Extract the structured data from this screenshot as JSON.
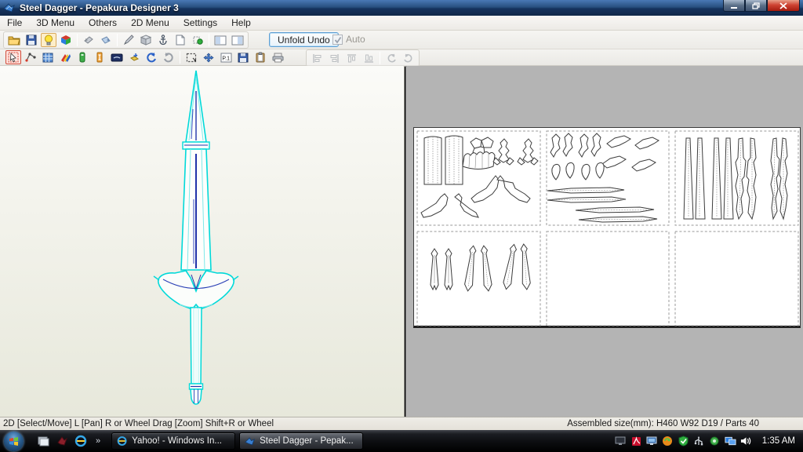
{
  "window": {
    "title": "Steel Dagger - Pepakura Designer 3"
  },
  "menu": {
    "items": [
      {
        "label": "File"
      },
      {
        "label": "3D Menu"
      },
      {
        "label": "Others"
      },
      {
        "label": "2D Menu"
      },
      {
        "label": "Settings"
      },
      {
        "label": "Help"
      }
    ]
  },
  "toolbar": {
    "unfold_undo_label": "Unfold Undo",
    "auto_label": "Auto",
    "auto_checked": true,
    "page_icon_label": "P.1",
    "row1_icons": [
      "open-file",
      "save",
      "light-bulb-toggle",
      "texture-cube",
      "flip-left",
      "flip-right",
      "pen",
      "solid-box",
      "anchor",
      "page",
      "marker-ball",
      "layout-left",
      "layout-right"
    ],
    "row2_icons": [
      "select-move",
      "edit-edge",
      "grid-texture",
      "fold-stripes",
      "info-green",
      "text-orange",
      "material-dark",
      "box-arrow",
      "rotate-ccw",
      "rotate-cw",
      "select-area",
      "move-part",
      "page-number",
      "save-part",
      "clipboard",
      "print"
    ],
    "row2_right_icons": [
      "align-left",
      "align-right",
      "align-top",
      "align-bottom",
      "rotate-90-ccw",
      "rotate-90-cw"
    ]
  },
  "status": {
    "left": "2D [Select/Move] L [Pan] R or Wheel Drag [Zoom] Shift+R or Wheel",
    "right": "Assembled size(mm): H460 W92 D19 / Parts 40"
  },
  "taskbar": {
    "overflow_chevron": "»",
    "buttons": [
      {
        "label": "Yahoo! - Windows In..."
      },
      {
        "label": "Steel Dagger - Pepak..."
      }
    ],
    "clock": "1:35 AM"
  },
  "viewport": {
    "assembled_parts_pages": 6,
    "pages_with_parts": 4
  },
  "colors": {
    "wireframe_cyan": "#00d9d9",
    "wireframe_navy": "#2233aa",
    "titlebar_blue": "#1d4375",
    "pane3d_bg": "#edeee3",
    "pane2d_bg": "#b4b4b4",
    "close_red": "#cf4433"
  }
}
